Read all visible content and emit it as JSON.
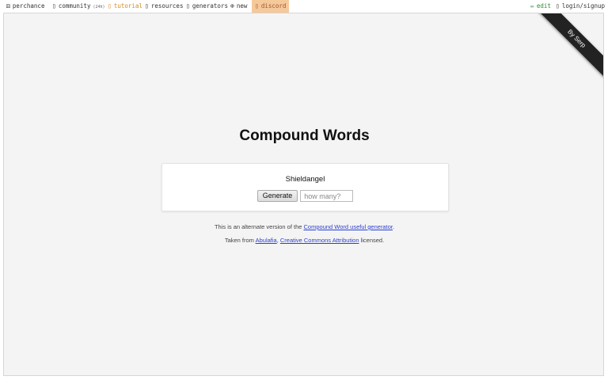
{
  "topbar": {
    "perchance": "perchance",
    "community": "community",
    "community_badge": "(24h)",
    "tutorial": "tutorial",
    "resources": "resources",
    "generators": "generators",
    "new": "new",
    "discord": "discord",
    "edit": "edit",
    "login": "login/signup",
    "icons": {
      "perchance": "dice-icon",
      "community": "chat-icon",
      "tutorial": "book-icon",
      "resources": "folder-icon",
      "generators": "grid-icon",
      "new": "plus-circle-icon",
      "discord": "discord-icon",
      "edit": "pencil-icon",
      "login": "user-icon"
    },
    "colors": {
      "tutorial": "#d98a1e",
      "discord_bg": "#f5c99a",
      "edit": "#2e8b2e"
    }
  },
  "ribbon": {
    "text": "By Serp"
  },
  "main": {
    "title": "Compound Words",
    "output": "Shieldangel",
    "generate_label": "Generate",
    "count_placeholder": "how many?"
  },
  "footer": {
    "line1_prefix": "This is an alternate version of the ",
    "line1_link": "Compound Word useful generator",
    "line1_suffix": ".",
    "line2_prefix": "Taken from ",
    "line2_link1": "Abulafia",
    "line2_sep": ", ",
    "line2_link2": "Creative Commons Attribution",
    "line2_suffix": " licensed."
  }
}
